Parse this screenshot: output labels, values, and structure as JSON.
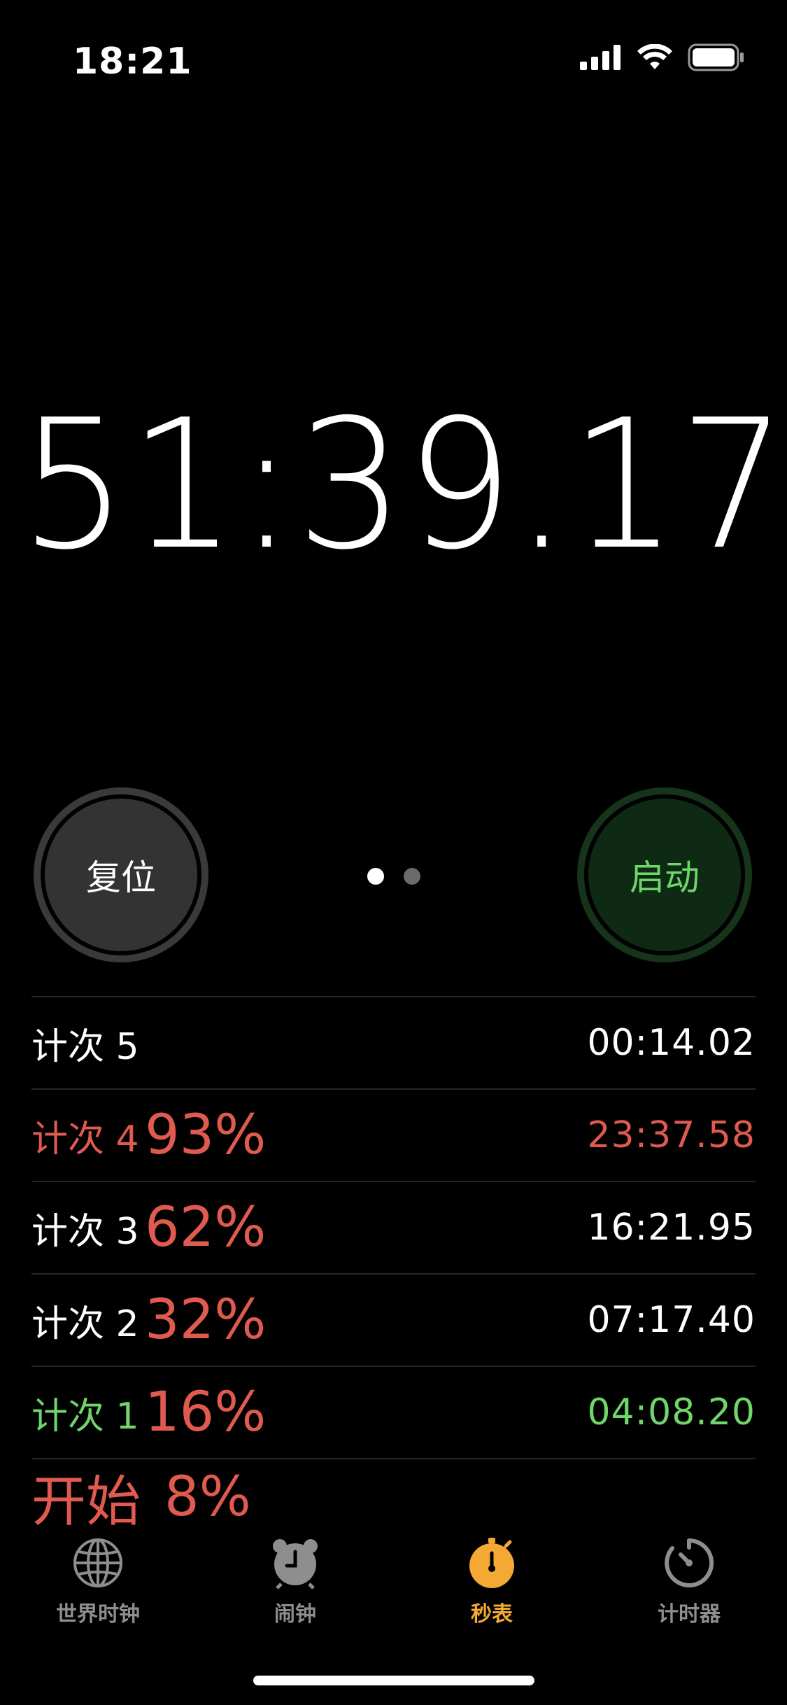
{
  "status_bar": {
    "time": "18:21"
  },
  "stopwatch": {
    "display": "51:39.17",
    "reset_label": "复位",
    "start_label": "启动",
    "page_dots": 2
  },
  "laps": [
    {
      "label": "计次 5",
      "percent": "",
      "time": "00:14.02",
      "color": "white"
    },
    {
      "label": "计次 4",
      "percent": "93%",
      "time": "23:37.58",
      "color": "red"
    },
    {
      "label": "计次 3",
      "percent": "62%",
      "time": "16:21.95",
      "color": "white"
    },
    {
      "label": "计次 2",
      "percent": "32%",
      "time": "07:17.40",
      "color": "white"
    },
    {
      "label": "计次 1",
      "percent": "16%",
      "time": "04:08.20",
      "color": "green"
    }
  ],
  "start_row": {
    "label": "开始",
    "percent": "8%"
  },
  "tabs": [
    {
      "label": "世界时钟",
      "icon": "globe-icon",
      "active": false
    },
    {
      "label": "闹钟",
      "icon": "alarm-clock-icon",
      "active": false
    },
    {
      "label": "秒表",
      "icon": "stopwatch-icon",
      "active": true
    },
    {
      "label": "计时器",
      "icon": "timer-icon",
      "active": false
    }
  ],
  "colors": {
    "accent": "#f4a935",
    "red": "#e05a4f",
    "green": "#6fd66a"
  }
}
